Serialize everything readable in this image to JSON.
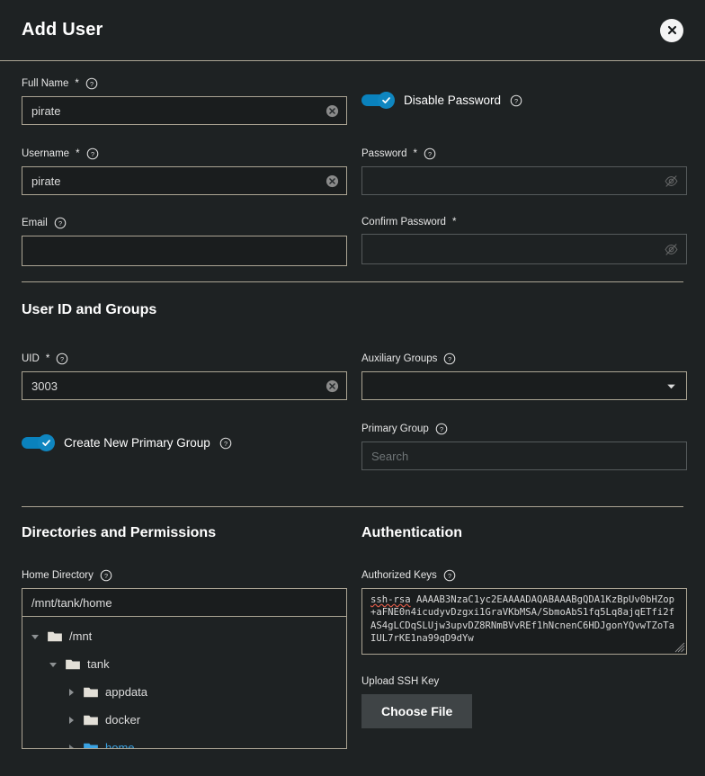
{
  "dialog": {
    "title": "Add User",
    "close_icon": "close-circle-icon"
  },
  "icons": {
    "help": "help-circle-icon",
    "clear": "clear-circle-icon",
    "eye_off": "eye-off-icon",
    "chevron_down": "chevron-down-icon",
    "folder": "folder-icon",
    "caret_right": "caret-right-icon",
    "caret_down": "caret-down-icon"
  },
  "colors": {
    "accent": "#0f86c0",
    "selected_tree": "#3aa3e3",
    "divider": "#aba493",
    "background": "#1e2223",
    "input_background": "#1a1d1e",
    "button": "#3f4446"
  },
  "identification": {
    "full_name": {
      "label": "Full Name",
      "required": true,
      "value": "pirate",
      "placeholder": ""
    },
    "username": {
      "label": "Username",
      "required": true,
      "value": "pirate",
      "placeholder": ""
    },
    "email": {
      "label": "Email",
      "required": false,
      "value": "",
      "placeholder": ""
    },
    "disable_password": {
      "label": "Disable Password",
      "enabled": true
    },
    "password": {
      "label": "Password",
      "required": true,
      "value": "",
      "placeholder": "",
      "disabled": true
    },
    "confirm_password": {
      "label": "Confirm Password",
      "required": true,
      "value": "",
      "placeholder": "",
      "disabled": true,
      "has_help": false
    }
  },
  "user_id_and_groups": {
    "section_title": "User ID and Groups",
    "uid": {
      "label": "UID",
      "required": true,
      "value": "3003"
    },
    "auxiliary_groups": {
      "label": "Auxiliary Groups",
      "value": "",
      "placeholder": ""
    },
    "create_new_primary_group": {
      "label": "Create New Primary Group",
      "enabled": true
    },
    "primary_group": {
      "label": "Primary Group",
      "value": "",
      "placeholder": "Search",
      "disabled": true
    }
  },
  "directories_and_permissions": {
    "section_title": "Directories and Permissions",
    "home_directory": {
      "label": "Home Directory",
      "value": "/mnt/tank/home"
    },
    "tree": [
      {
        "label": "/mnt",
        "depth": 0,
        "expanded": true,
        "selected": false
      },
      {
        "label": "tank",
        "depth": 1,
        "expanded": true,
        "selected": false
      },
      {
        "label": "appdata",
        "depth": 2,
        "expanded": false,
        "selected": false
      },
      {
        "label": "docker",
        "depth": 2,
        "expanded": false,
        "selected": false
      },
      {
        "label": "home",
        "depth": 2,
        "expanded": false,
        "selected": true
      }
    ]
  },
  "authentication": {
    "section_title": "Authentication",
    "authorized_keys": {
      "label": "Authorized Keys",
      "value_prefix": "ssh-rsa",
      "value_rest": " AAAAB3NzaC1yc2EAAAADAQABAAABgQDA1KzBpUv0bHZop+aFNE0n4icudyvDzgxi1GraVKbMSA/SbmoAbS1fq5Lq8ajqETfi2fAS4gLCDqSLUjw3upvDZ8RNmBVvREf1hNcnenC6HDJgonYQvwTZoTaIUL7rKE1na99qD9dYw"
    },
    "upload_ssh_key": {
      "label": "Upload SSH Key",
      "button_label": "Choose File"
    }
  }
}
